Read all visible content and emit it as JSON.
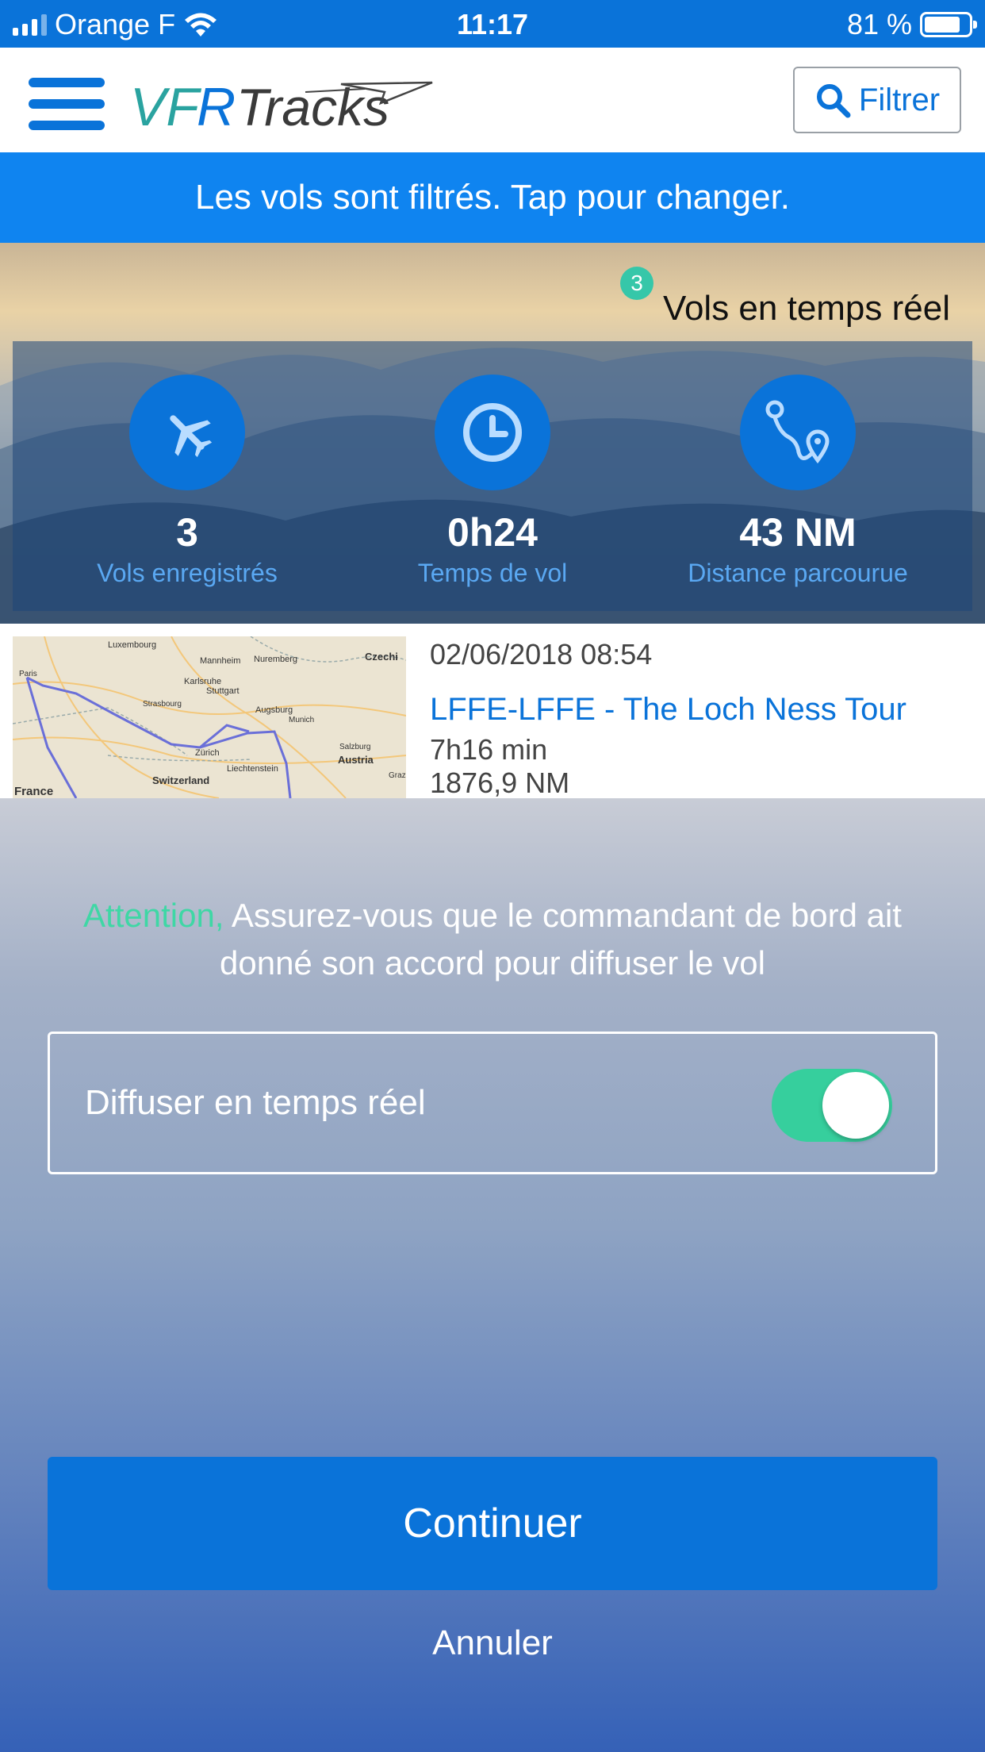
{
  "status_bar": {
    "carrier": "Orange F",
    "time": "11:17",
    "battery": "81 %"
  },
  "navbar": {
    "logo_text": "VFR Tracks",
    "filter_label": "Filtrer"
  },
  "banner": {
    "text": "Les vols sont filtrés. Tap pour changer."
  },
  "hero": {
    "live_count": "3",
    "live_label": "Vols en temps réel",
    "stats": [
      {
        "value": "3",
        "label": "Vols enregistrés",
        "icon": "airplane-icon"
      },
      {
        "value": "0h24",
        "label": "Temps de vol",
        "icon": "clock-icon"
      },
      {
        "value": "43 NM",
        "label": "Distance parcourue",
        "icon": "route-icon"
      }
    ]
  },
  "flight": {
    "date": "02/06/2018 08:54",
    "title": "LFFE-LFFE - The Loch Ness Tour",
    "duration": "7h16 min",
    "distance": "1876,9 NM",
    "map_labels": {
      "luxembourg": "Luxembourg",
      "nuremberg": "Nuremberg",
      "czechia": "Czechi",
      "mannheim": "Mannheim",
      "karlsruhe": "Karlsruhe",
      "stuttgart": "Stuttgart",
      "strasbourg": "Strasbourg",
      "augsburg": "Augsburg",
      "munich": "Munich",
      "austria": "Austria",
      "zurich": "Zürich",
      "liechtenstein": "Liechtenstein",
      "switzerland": "Switzerland",
      "france": "France",
      "paris": "Paris",
      "salzburg": "Salzburg",
      "graz": "Graz"
    }
  },
  "dialog": {
    "attention": "Attention,",
    "warning": "Assurez-vous que le commandant de bord ait donné son accord pour diffuser le vol",
    "toggle_label": "Diffuser en temps réel",
    "toggle_on": true,
    "continue_label": "Continuer",
    "cancel_label": "Annuler"
  },
  "colors": {
    "primary": "#0a73d9",
    "banner": "#0f84f0",
    "accent_green": "#36cf9d",
    "badge": "#36c7a9"
  }
}
